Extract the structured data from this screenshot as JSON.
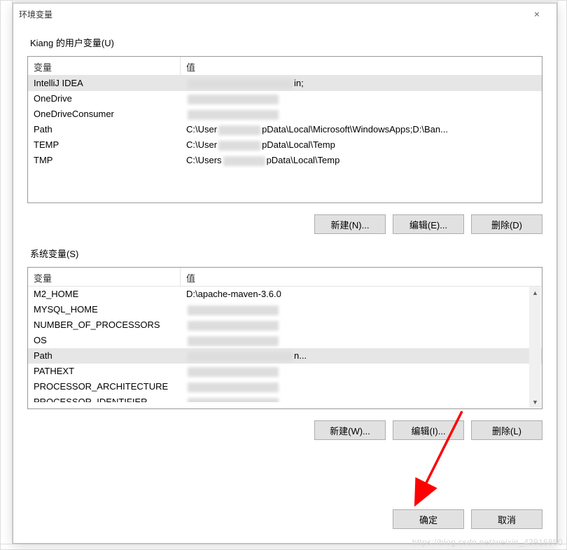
{
  "dialog": {
    "title": "环境变量",
    "close_icon": "×"
  },
  "user_section": {
    "label": "Kiang 的用户变量(U)",
    "col_var": "变量",
    "col_val": "值",
    "rows": [
      {
        "name": "IntelliJ IDEA",
        "value_suffix": "in;",
        "censored": true,
        "selected": true
      },
      {
        "name": "OneDrive",
        "value_suffix": "",
        "censored": true
      },
      {
        "name": "OneDriveConsumer",
        "value_suffix": "",
        "censored": true
      },
      {
        "name": "Path",
        "value_prefix": "C:\\User",
        "value_suffix": "pData\\Local\\Microsoft\\WindowsApps;D:\\Ban...",
        "censored": true
      },
      {
        "name": "TEMP",
        "value_prefix": "C:\\User",
        "value_suffix": "pData\\Local\\Temp",
        "censored": true
      },
      {
        "name": "TMP",
        "value_prefix": "C:\\Users",
        "value_suffix": "pData\\Local\\Temp",
        "censored": true
      }
    ],
    "btn_new": "新建(N)...",
    "btn_edit": "编辑(E)...",
    "btn_delete": "删除(D)"
  },
  "system_section": {
    "label": "系统变量(S)",
    "col_var": "变量",
    "col_val": "值",
    "rows": [
      {
        "name": "M2_HOME",
        "value": "D:\\apache-maven-3.6.0"
      },
      {
        "name": "MYSQL_HOME",
        "censored": true
      },
      {
        "name": "NUMBER_OF_PROCESSORS",
        "censored": true
      },
      {
        "name": "OS",
        "censored": true
      },
      {
        "name": "Path",
        "censored": true,
        "value_suffix": "n...",
        "selected": true
      },
      {
        "name": "PATHEXT",
        "censored": true
      },
      {
        "name": "PROCESSOR_ARCHITECTURE",
        "censored": true
      },
      {
        "name": "PROCESSOR_IDENTIFIER",
        "censored": true,
        "cut": true
      }
    ],
    "btn_new": "新建(W)...",
    "btn_edit": "编辑(I)...",
    "btn_delete": "删除(L)"
  },
  "footer": {
    "ok": "确定",
    "cancel": "取消"
  },
  "watermark": "https://blog.csdn.net/weixin_43916850"
}
